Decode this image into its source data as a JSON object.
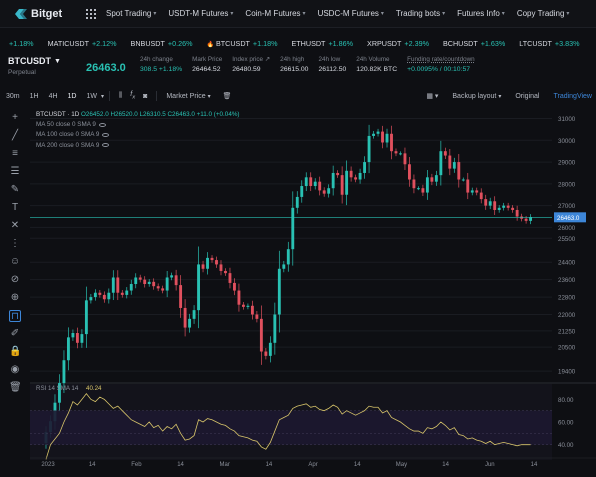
{
  "nav": {
    "logo_text": "Bitget",
    "items": [
      {
        "label": "Spot Trading"
      },
      {
        "label": "USDT-M Futures"
      },
      {
        "label": "Coin-M Futures"
      },
      {
        "label": "USDC-M Futures"
      },
      {
        "label": "Trading bots"
      },
      {
        "label": "Futures Info"
      },
      {
        "label": "Copy Trading"
      }
    ]
  },
  "ticker": [
    {
      "symbol": "",
      "change": "+1.18%",
      "hot": false
    },
    {
      "symbol": "MATICUSDT",
      "change": "+2.12%",
      "hot": false
    },
    {
      "symbol": "BNBUSDT",
      "change": "+0.26%",
      "hot": false
    },
    {
      "symbol": "BTCUSDT",
      "change": "+1.18%",
      "hot": true
    },
    {
      "symbol": "ETHUSDT",
      "change": "+1.86%",
      "hot": false
    },
    {
      "symbol": "XRPUSDT",
      "change": "+2.39%",
      "hot": false
    },
    {
      "symbol": "BCHUSDT",
      "change": "+1.63%",
      "hot": false
    },
    {
      "symbol": "LTCUSDT",
      "change": "+3.83%",
      "hot": false
    }
  ],
  "market": {
    "symbol": "BTCUSDT",
    "sub": "Perpetual",
    "last_price": "26463.0",
    "stats": [
      {
        "label": "24h change",
        "value": "308.5 +1.18%",
        "green": true
      },
      {
        "label": "Mark Price",
        "value": "26464.52",
        "green": false
      },
      {
        "label": "Index price",
        "value": "26480.59",
        "green": false
      },
      {
        "label": "24h high",
        "value": "26615.00",
        "green": false
      },
      {
        "label": "24h low",
        "value": "26112.50",
        "green": false
      },
      {
        "label": "24h Volume",
        "value": "120.82K BTC",
        "green": false
      },
      {
        "label": "Funding rate/countdown",
        "value": "+0.0095% / 00:10:57",
        "green": true
      }
    ]
  },
  "toolbar": {
    "timeframes": [
      "30m",
      "1H",
      "4H",
      "1D",
      "1W"
    ],
    "selected_tf": "1D",
    "price_type": "Market Price",
    "backup_layout": "Backup layout",
    "original": "Original",
    "tradingview": "TradingView"
  },
  "legend": {
    "title": "BTCUSDT · 1D",
    "ohlc": "O26452.0 H26520.0 L26310.5 C26463.0 +11.0 (+0.04%)",
    "ma": [
      "MA 50 close 0 SMA 9",
      "MA 100 close 0 SMA 9",
      "MA 200 close 0 SMA 9"
    ]
  },
  "rsi": {
    "label": "RSI 14 SMA 14",
    "value": "40.24"
  },
  "chart_data": {
    "type": "candlestick",
    "price_axis_ticks": [
      31000,
      30000,
      29000,
      28000,
      27000,
      26000,
      25500,
      24400,
      23600,
      22800,
      22000,
      21250,
      20500,
      19400
    ],
    "current_price_label": "26463.0",
    "price_range": [
      18900,
      31300
    ],
    "x_ticks": [
      "2023",
      "14",
      "Feb",
      "14",
      "Mar",
      "14",
      "Apr",
      "14",
      "May",
      "14",
      "Jun",
      "14"
    ],
    "rsi_ticks": [
      80,
      60,
      40
    ],
    "rsi_range": [
      30,
      90
    ],
    "closes": [
      16600,
      17100,
      17950,
      18850,
      19900,
      20950,
      21150,
      20700,
      21100,
      22650,
      22800,
      23000,
      22900,
      22700,
      23000,
      23700,
      23000,
      22900,
      23100,
      23400,
      23700,
      23600,
      23400,
      23500,
      23300,
      23200,
      23100,
      23700,
      23800,
      23350,
      22300,
      21400,
      21800,
      22200,
      24300,
      24100,
      24600,
      24500,
      24300,
      24000,
      23900,
      23450,
      23100,
      22450,
      22350,
      22400,
      22000,
      21800,
      20300,
      20100,
      20700,
      22000,
      24100,
      24300,
      25000,
      26900,
      27400,
      27900,
      28300,
      27900,
      28100,
      27700,
      27550,
      27800,
      28500,
      28400,
      27500,
      28600,
      28300,
      28200,
      28500,
      29000,
      30200,
      30300,
      30400,
      29900,
      30300,
      29500,
      29400,
      29400,
      28900,
      28200,
      27800,
      27800,
      27600,
      28300,
      28100,
      28400,
      29500,
      29300,
      28700,
      29000,
      28200,
      28200,
      27600,
      27700,
      27600,
      27300,
      27000,
      27200,
      26800,
      26900,
      27000,
      26900,
      26800,
      26500,
      26400,
      26300,
      26463
    ],
    "rsi": [
      27,
      40,
      45,
      50,
      60,
      68,
      78,
      75,
      80,
      85,
      80,
      78,
      82,
      80,
      76,
      72,
      74,
      70,
      66,
      62,
      60,
      58,
      56,
      60,
      55,
      57,
      52,
      56,
      54,
      58,
      50,
      44,
      45,
      48,
      62,
      60,
      63,
      62,
      60,
      58,
      57,
      54,
      52,
      48,
      47,
      46,
      44,
      43,
      38,
      36,
      42,
      52,
      62,
      64,
      66,
      72,
      74,
      75,
      76,
      73,
      74,
      71,
      70,
      72,
      75,
      73,
      67,
      70,
      68,
      66,
      68,
      70,
      74,
      73,
      73,
      68,
      70,
      64,
      62,
      60,
      57,
      54,
      52,
      52,
      50,
      55,
      54,
      56,
      60,
      57,
      53,
      55,
      49,
      48,
      45,
      46,
      44,
      43,
      41,
      43,
      40,
      41,
      42,
      41,
      40,
      39,
      40,
      40,
      40
    ]
  }
}
